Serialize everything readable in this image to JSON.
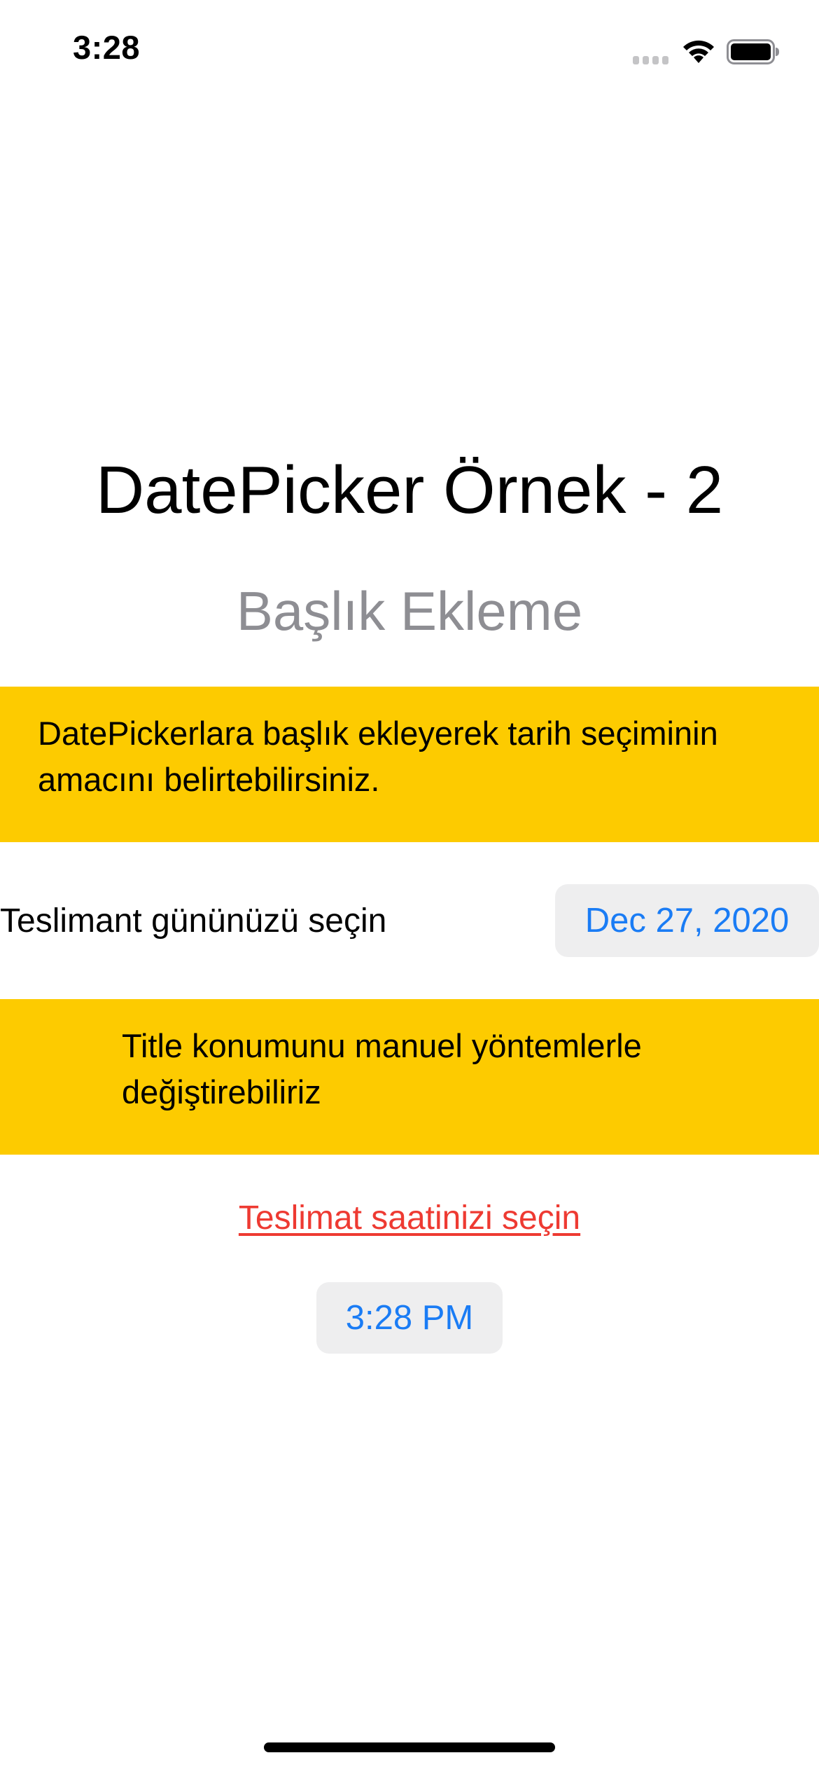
{
  "status_bar": {
    "time": "3:28",
    "icons": [
      "cellular-signal-icon",
      "wifi-icon",
      "battery-icon"
    ]
  },
  "header": {
    "title": "DatePicker Örnek - 2",
    "subtitle": "Başlık Ekleme"
  },
  "info_banner_1": {
    "text": "DatePickerlara başlık ekleyerek tarih seçiminin amacını belirtebilirsiniz."
  },
  "date_picker": {
    "label": "Teslimant gününüzü seçin",
    "value": "Dec 27, 2020"
  },
  "info_banner_2": {
    "text": "Title konumunu manuel yöntemlerle değiştirebiliriz"
  },
  "time_picker": {
    "label": "Teslimat saatinizi seçin",
    "value": "3:28 PM"
  },
  "colors": {
    "banner": "#fdcb00",
    "accent_blue": "#1a7cf5",
    "label_red": "#ee3a32",
    "subtitle_gray": "#8e8e93",
    "pill_background": "#eeeeef"
  }
}
